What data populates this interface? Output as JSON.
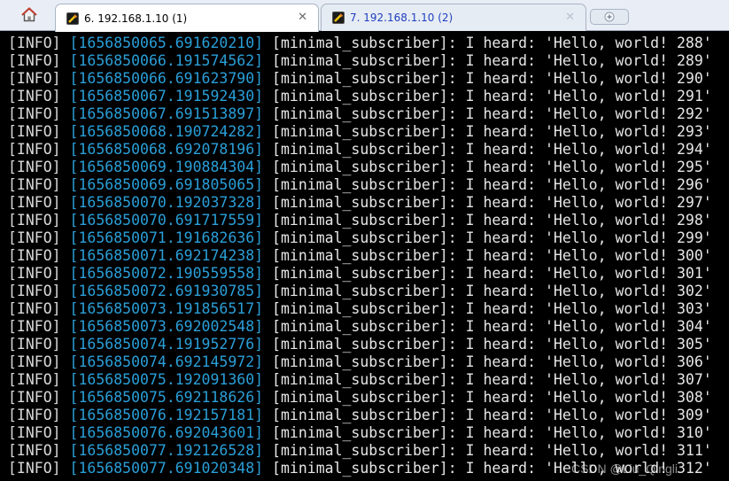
{
  "tabs": [
    {
      "label": "6. 192.168.1.10 (1)",
      "active": true,
      "close": "✕"
    },
    {
      "label": "7. 192.168.1.10 (2)",
      "active": false,
      "close": "✕"
    }
  ],
  "terminal": {
    "colors": {
      "background": "#000000",
      "level": "#d9d9d9",
      "timestamp": "#2a9fd8",
      "text": "#e6e6e6"
    },
    "lines": [
      {
        "level": "[INFO]",
        "ts": "[1656850065.691620210]",
        "msg": "[minimal_subscriber]: I heard: 'Hello, world! 288'"
      },
      {
        "level": "[INFO]",
        "ts": "[1656850066.191574562]",
        "msg": "[minimal_subscriber]: I heard: 'Hello, world! 289'"
      },
      {
        "level": "[INFO]",
        "ts": "[1656850066.691623790]",
        "msg": "[minimal_subscriber]: I heard: 'Hello, world! 290'"
      },
      {
        "level": "[INFO]",
        "ts": "[1656850067.191592430]",
        "msg": "[minimal_subscriber]: I heard: 'Hello, world! 291'"
      },
      {
        "level": "[INFO]",
        "ts": "[1656850067.691513897]",
        "msg": "[minimal_subscriber]: I heard: 'Hello, world! 292'"
      },
      {
        "level": "[INFO]",
        "ts": "[1656850068.190724282]",
        "msg": "[minimal_subscriber]: I heard: 'Hello, world! 293'"
      },
      {
        "level": "[INFO]",
        "ts": "[1656850068.692078196]",
        "msg": "[minimal_subscriber]: I heard: 'Hello, world! 294'"
      },
      {
        "level": "[INFO]",
        "ts": "[1656850069.190884304]",
        "msg": "[minimal_subscriber]: I heard: 'Hello, world! 295'"
      },
      {
        "level": "[INFO]",
        "ts": "[1656850069.691805065]",
        "msg": "[minimal_subscriber]: I heard: 'Hello, world! 296'"
      },
      {
        "level": "[INFO]",
        "ts": "[1656850070.192037328]",
        "msg": "[minimal_subscriber]: I heard: 'Hello, world! 297'"
      },
      {
        "level": "[INFO]",
        "ts": "[1656850070.691717559]",
        "msg": "[minimal_subscriber]: I heard: 'Hello, world! 298'"
      },
      {
        "level": "[INFO]",
        "ts": "[1656850071.191682636]",
        "msg": "[minimal_subscriber]: I heard: 'Hello, world! 299'"
      },
      {
        "level": "[INFO]",
        "ts": "[1656850071.692174238]",
        "msg": "[minimal_subscriber]: I heard: 'Hello, world! 300'"
      },
      {
        "level": "[INFO]",
        "ts": "[1656850072.190559558]",
        "msg": "[minimal_subscriber]: I heard: 'Hello, world! 301'"
      },
      {
        "level": "[INFO]",
        "ts": "[1656850072.691930785]",
        "msg": "[minimal_subscriber]: I heard: 'Hello, world! 302'"
      },
      {
        "level": "[INFO]",
        "ts": "[1656850073.191856517]",
        "msg": "[minimal_subscriber]: I heard: 'Hello, world! 303'"
      },
      {
        "level": "[INFO]",
        "ts": "[1656850073.692002548]",
        "msg": "[minimal_subscriber]: I heard: 'Hello, world! 304'"
      },
      {
        "level": "[INFO]",
        "ts": "[1656850074.191952776]",
        "msg": "[minimal_subscriber]: I heard: 'Hello, world! 305'"
      },
      {
        "level": "[INFO]",
        "ts": "[1656850074.692145972]",
        "msg": "[minimal_subscriber]: I heard: 'Hello, world! 306'"
      },
      {
        "level": "[INFO]",
        "ts": "[1656850075.192091360]",
        "msg": "[minimal_subscriber]: I heard: 'Hello, world! 307'"
      },
      {
        "level": "[INFO]",
        "ts": "[1656850075.692118626]",
        "msg": "[minimal_subscriber]: I heard: 'Hello, world! 308'"
      },
      {
        "level": "[INFO]",
        "ts": "[1656850076.192157181]",
        "msg": "[minimal_subscriber]: I heard: 'Hello, world! 309'"
      },
      {
        "level": "[INFO]",
        "ts": "[1656850076.692043601]",
        "msg": "[minimal_subscriber]: I heard: 'Hello, world! 310'"
      },
      {
        "level": "[INFO]",
        "ts": "[1656850077.192126528]",
        "msg": "[minimal_subscriber]: I heard: 'Hello, world! 311'"
      },
      {
        "level": "[INFO]",
        "ts": "[1656850077.691020348]",
        "msg": "[minimal_subscriber]: I heard: 'Hello, world! 312'"
      }
    ]
  },
  "watermark": "CSDN @Liu_Qingli"
}
